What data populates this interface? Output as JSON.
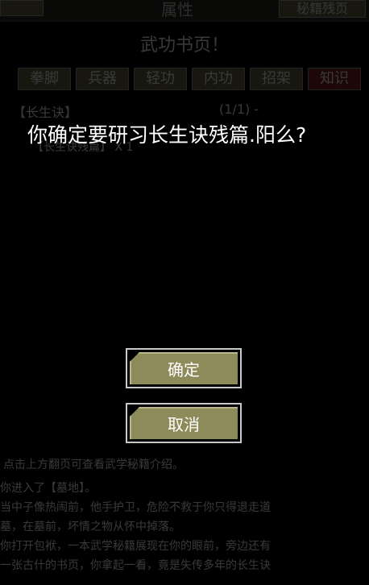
{
  "background": {
    "top_title": "属性",
    "top_right_button": "秘籍残页",
    "page_title": "武功书页！",
    "tabs": [
      {
        "label": "拳脚",
        "active": false
      },
      {
        "label": "兵器",
        "active": false
      },
      {
        "label": "轻功",
        "active": false
      },
      {
        "label": "内功",
        "active": false
      },
      {
        "label": "招架",
        "active": false
      },
      {
        "label": "知识",
        "active": true
      }
    ],
    "entry_name": "【长生诀】",
    "entry_page": "(1/1) -",
    "entry_sub": "【长生诀残篇】 X 1",
    "hint": "点击上方翻页可查看武学秘籍介绍。",
    "log": [
      "你进入了【墓地】。",
      "当中子像热闹前，他手护卫，危险不救于你只得退走道",
      "墓，在墓前，坏情之物从怀中掉落。",
      "你打开包袱，一本武学秘籍展现在你的眼前，旁边还有",
      "一张古什的书页，你拿起一看，竟是失传多年的长生诀"
    ]
  },
  "dialog": {
    "question": "你确定要研习长生诀残篇.阳么?",
    "confirm_label": "确定",
    "cancel_label": "取消"
  },
  "colors": {
    "button_fill": "#8e8b5a",
    "button_border": "#c8c8c8",
    "active_tab": "#8a2020",
    "background": "#000000"
  }
}
